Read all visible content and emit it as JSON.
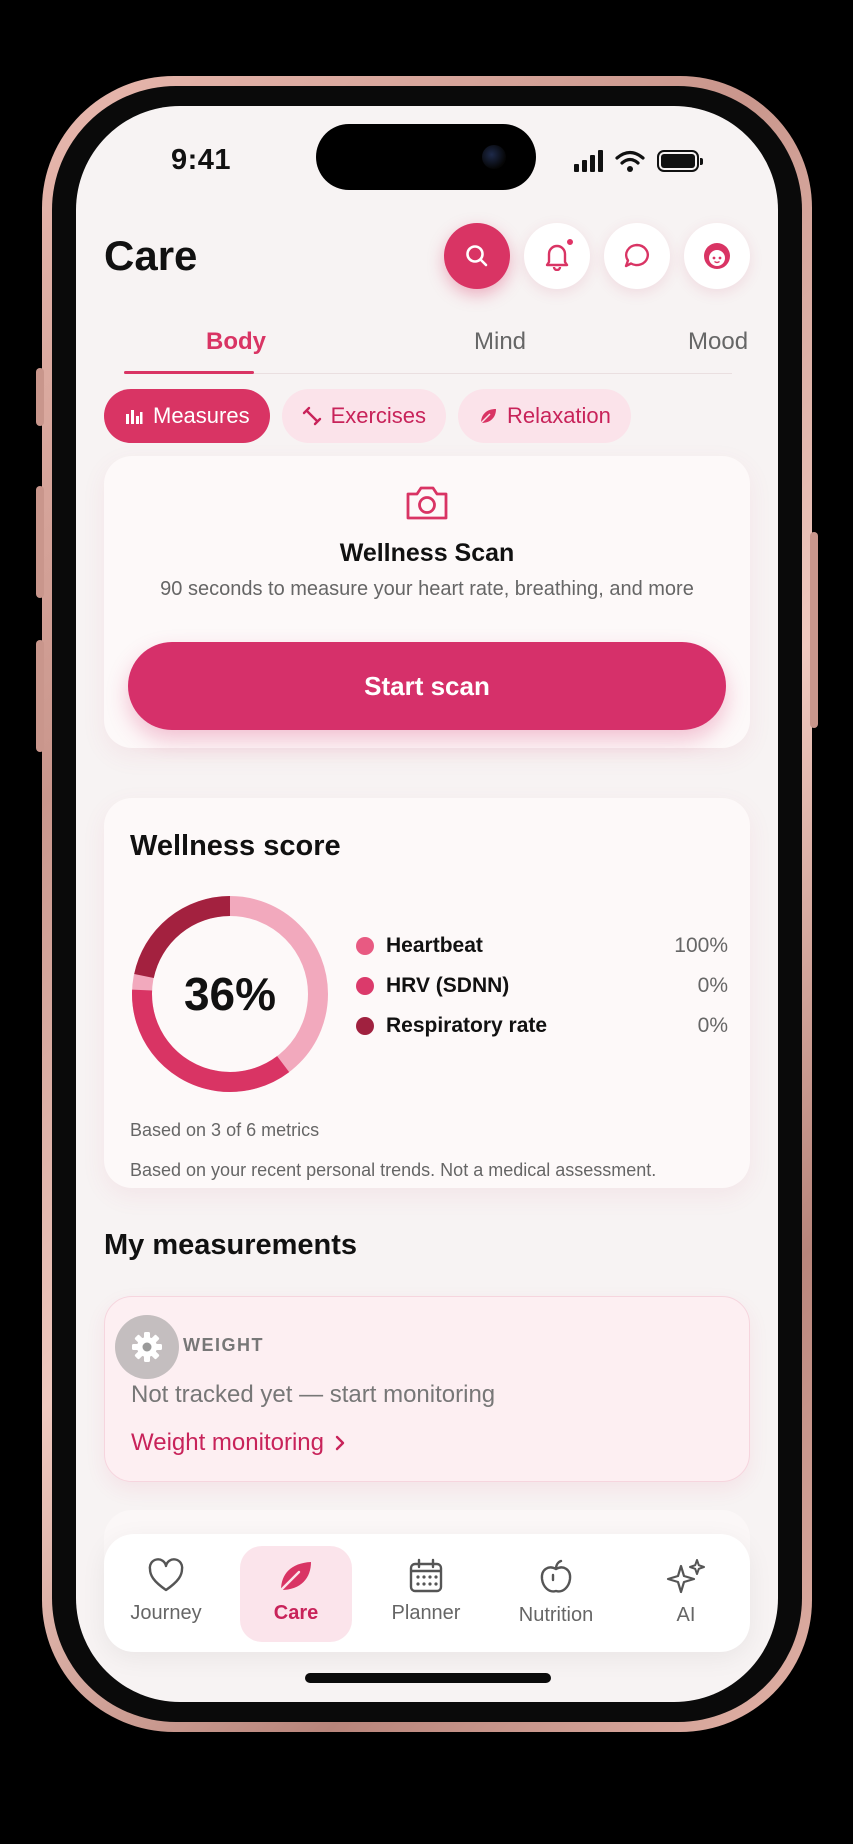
{
  "status_bar": {
    "time": "9:41"
  },
  "header": {
    "title": "Care",
    "buttons": [
      {
        "icon": "search-icon"
      },
      {
        "icon": "bell-icon"
      },
      {
        "icon": "chat-icon"
      },
      {
        "icon": "avatar-icon"
      }
    ]
  },
  "tabs": [
    {
      "label": "Body",
      "active": true
    },
    {
      "label": "Mind",
      "active": false
    },
    {
      "label": "Mood",
      "active": false
    }
  ],
  "chips": [
    {
      "label": "Measures",
      "icon": "bar-chart-icon",
      "active": true
    },
    {
      "label": "Exercises",
      "icon": "dumbbell-icon",
      "active": false
    },
    {
      "label": "Relaxation",
      "icon": "leaf-icon",
      "active": false
    }
  ],
  "scan_card": {
    "icon": "camera-icon",
    "title": "Wellness Scan",
    "subtitle": "90 seconds to measure your heart rate, breathing, and more",
    "button_label": "Start scan"
  },
  "wellness_score": {
    "title": "Wellness score",
    "value": "36%",
    "fraction": 0.36,
    "metrics": [
      {
        "label": "Heartbeat",
        "value": "100%",
        "color": "#e85a82"
      },
      {
        "label": "HRV (SDNN)",
        "value": "0%",
        "color": "#db3a6b"
      },
      {
        "label": "Respiratory rate",
        "value": "0%",
        "color": "#a0213f"
      }
    ],
    "note_metrics": "Based on 3 of 6 metrics",
    "note_disclaimer": "Based on your recent personal trends. Not a medical assessment."
  },
  "measurements": {
    "title": "My measurements",
    "weight": {
      "label": "WEIGHT",
      "status": "Not tracked yet — start monitoring",
      "link_label": "Weight monitoring",
      "link_icon": "chevron-right-icon"
    }
  },
  "bottom_nav": [
    {
      "label": "Journey",
      "icon": "heart-icon",
      "active": false
    },
    {
      "label": "Care",
      "icon": "leaf-icon",
      "active": true
    },
    {
      "label": "Planner",
      "icon": "calendar-icon",
      "active": false
    },
    {
      "label": "Nutrition",
      "icon": "apple-icon",
      "active": false
    },
    {
      "label": "AI",
      "icon": "sparkles-icon",
      "active": false
    }
  ],
  "colors": {
    "accent": "#d93464",
    "ring_track": "#f7c9d6",
    "background": "#f7f3f3"
  }
}
